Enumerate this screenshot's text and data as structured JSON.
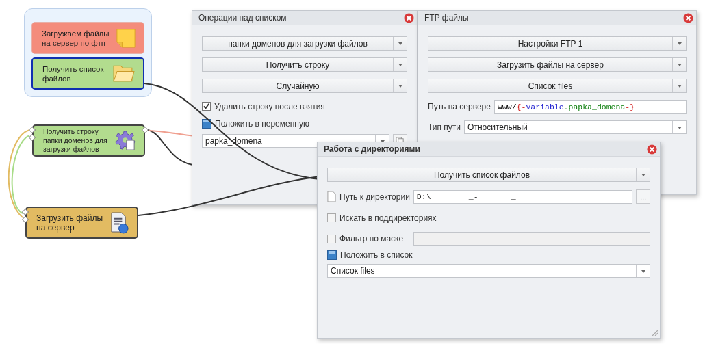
{
  "canvas": {
    "group": {
      "nodes": [
        {
          "label": "Загружаем файлы на сервер по фтп",
          "kind": "note",
          "color": "#f48c7c",
          "selected": false
        },
        {
          "label": "Получить список файлов",
          "kind": "folder",
          "color": "#b2dc8e",
          "selected": true
        }
      ]
    },
    "nodes": [
      {
        "label": "Получить строку папки доменов для загрузки файлов",
        "kind": "gear",
        "color": "#b2dc8e",
        "selected": false
      },
      {
        "label": "Загрузить файлы на сервер",
        "kind": "upload",
        "color": "#e2bb62",
        "selected": false
      }
    ]
  },
  "windows": [
    {
      "title": "Операции над списком",
      "active": false,
      "fields": [
        {
          "kind": "select",
          "value": "папки доменов для загрузки файлов"
        },
        {
          "kind": "select",
          "value": "Получить строку"
        },
        {
          "kind": "select",
          "value": "Случайную"
        },
        {
          "kind": "checkbox",
          "label": "Удалить строку после взятия",
          "checked": true
        },
        {
          "kind": "save-label",
          "label": "Положить в переменную"
        },
        {
          "kind": "combo-copy",
          "value": "papka_domena"
        }
      ]
    },
    {
      "title": "FTP файлы",
      "active": false,
      "fields": [
        {
          "kind": "select",
          "value": "Настройки FTP 1"
        },
        {
          "kind": "select",
          "value": "Загрузить файлы на сервер"
        },
        {
          "kind": "select",
          "value": "Список files"
        },
        {
          "kind": "code-input",
          "label": "Путь на сервере",
          "tokens": [
            {
              "text": "www/",
              "kind": "plain"
            },
            {
              "text": "{-",
              "kind": "brace"
            },
            {
              "text": "Variable",
              "kind": "scope"
            },
            {
              "text": ".papka_domena",
              "kind": "name"
            },
            {
              "text": "-}",
              "kind": "brace"
            }
          ]
        },
        {
          "kind": "labeled-select",
          "label": "Тип пути",
          "value": "Относительный"
        }
      ]
    },
    {
      "title": "Работа с директориями",
      "active": true,
      "fields": [
        {
          "kind": "select",
          "value": "Получить список файлов"
        },
        {
          "kind": "file-input",
          "label": "Путь к директории",
          "value": "D:\\        _-       _",
          "button": "..."
        },
        {
          "kind": "checkbox",
          "label": "Искать в поддиректориях",
          "checked": false
        },
        {
          "kind": "checkbox-input",
          "label": "Фильтр по маске",
          "checked": false
        },
        {
          "kind": "save-label",
          "label": "Положить в список"
        },
        {
          "kind": "combo",
          "value": "Список files"
        }
      ]
    }
  ]
}
